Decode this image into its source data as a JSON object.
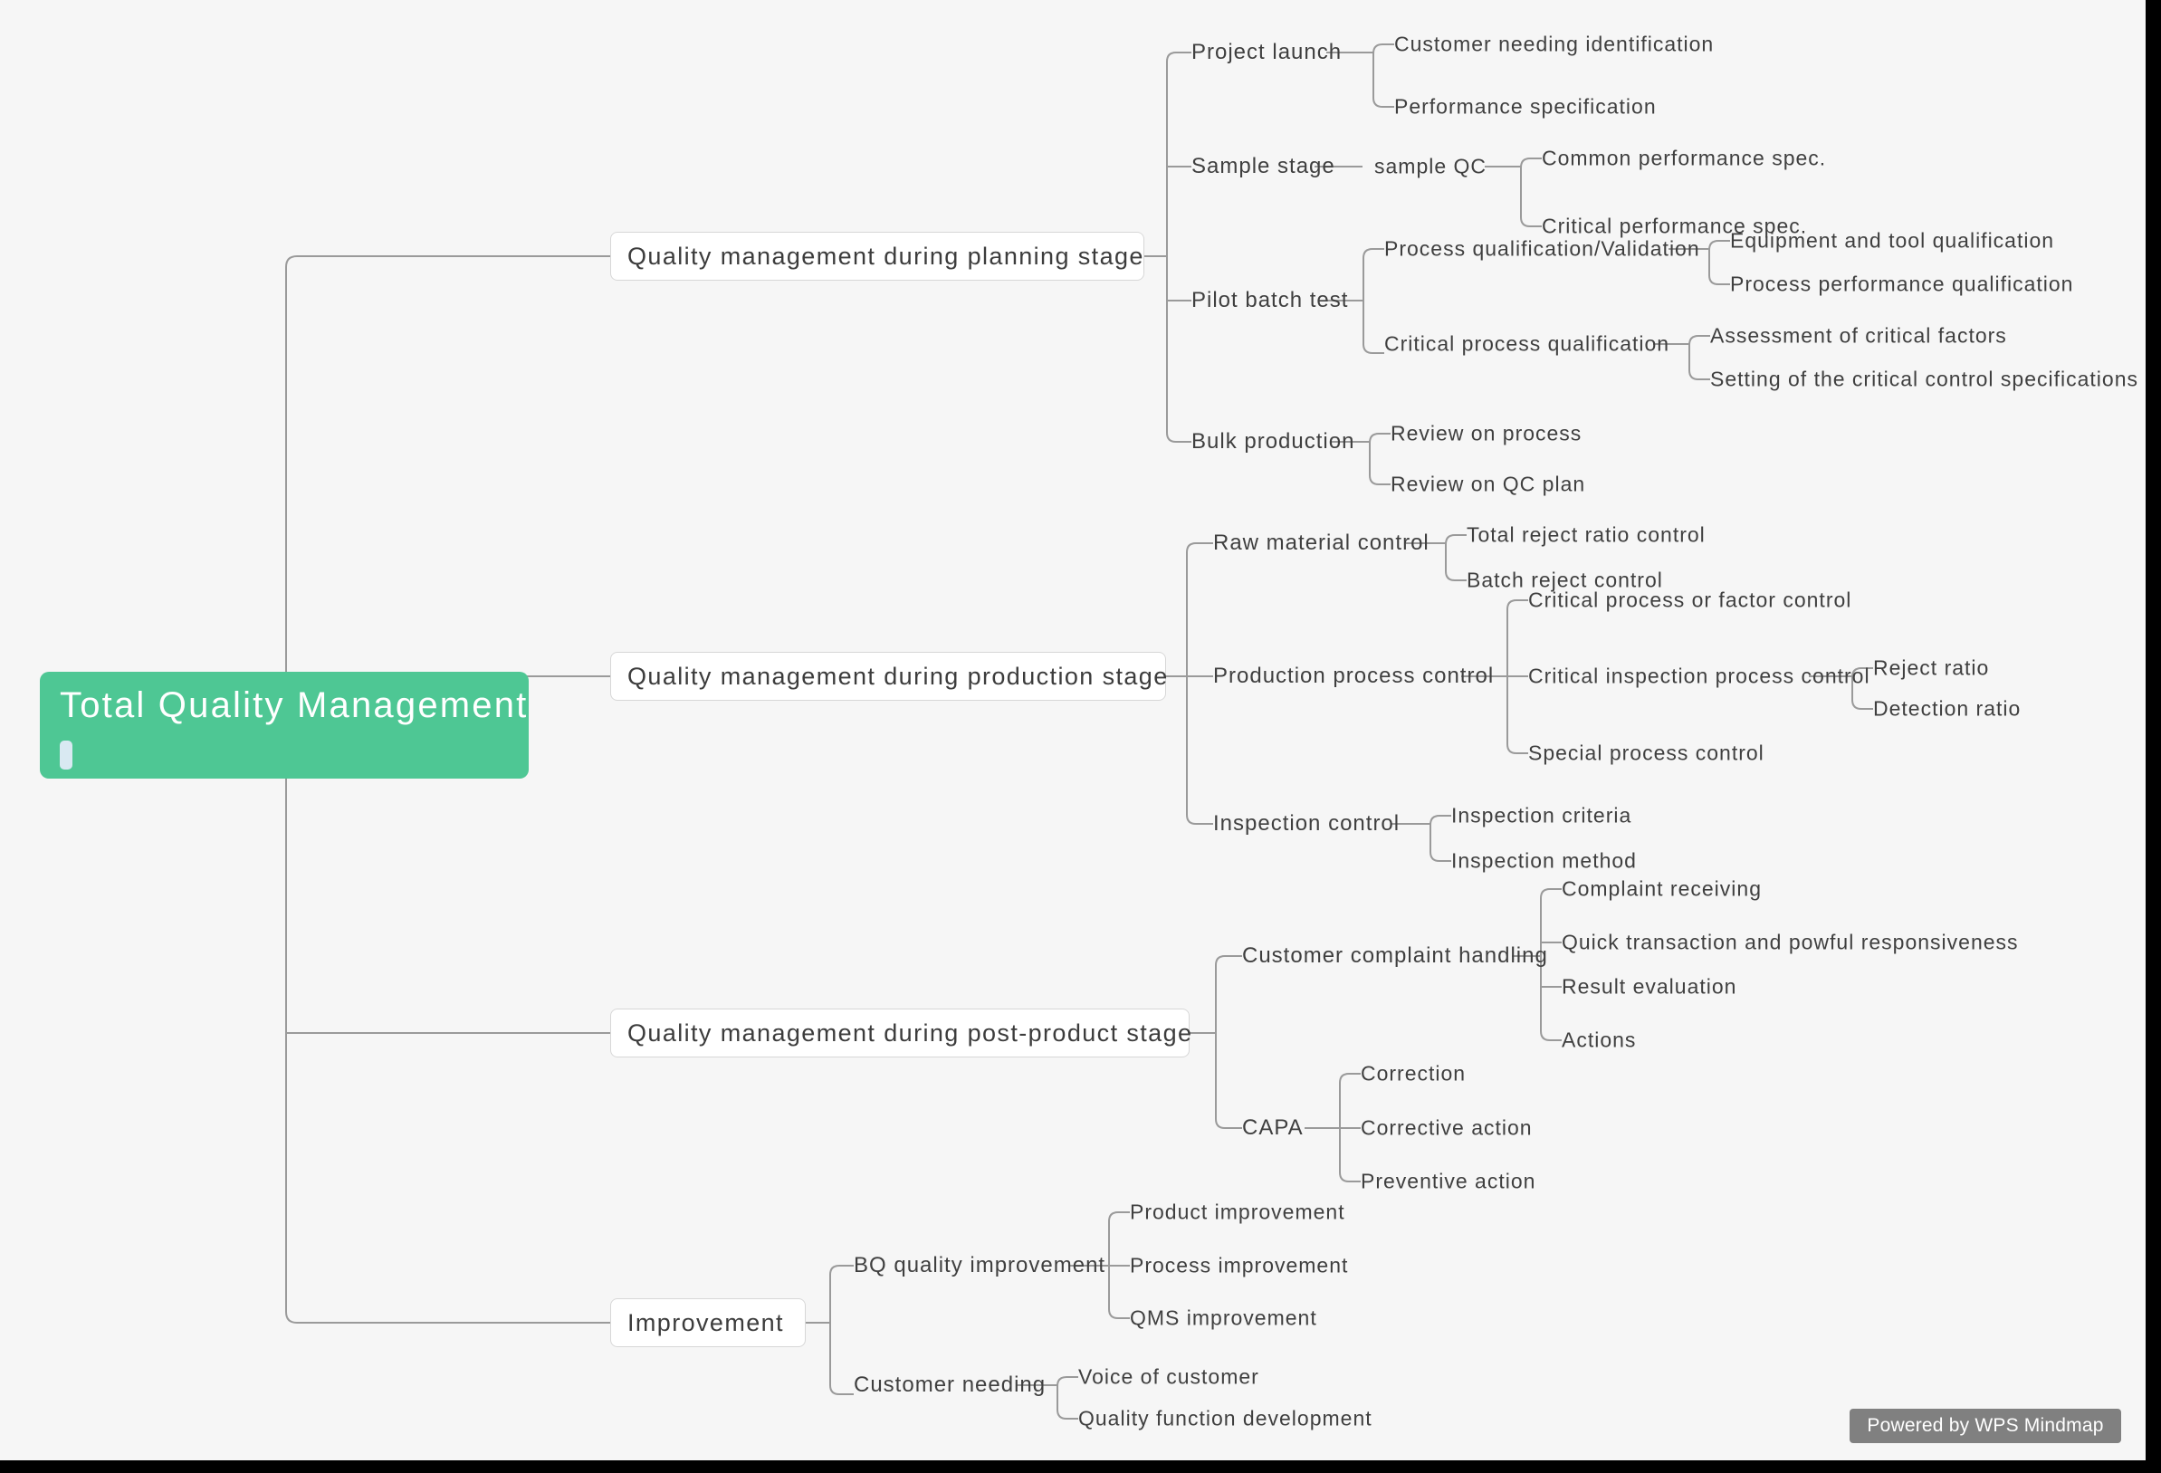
{
  "app": {
    "watermark": "Powered by WPS Mindmap",
    "background_color": "#f6f6f6",
    "line_color": "#9a9a9a",
    "root_color": "#4ec794",
    "node_text_color": "#3f3f3f"
  },
  "root": {
    "title": "Total  Quality  Management"
  },
  "branches": [
    {
      "label": "Quality  management  during  planning  stage",
      "children": [
        {
          "label": "Project  launch",
          "children": [
            {
              "label": "Customer  needing  identification"
            },
            {
              "label": "Performance  specification"
            }
          ]
        },
        {
          "label": "Sample  stage",
          "children": [
            {
              "label": "sample QC",
              "children": [
                {
                  "label": "Common  performance  spec."
                },
                {
                  "label": "Critical  performance  spec."
                }
              ]
            }
          ]
        },
        {
          "label": "Pilot  batch  test",
          "children": [
            {
              "label": "Process  qualification/Validation",
              "children": [
                {
                  "label": "Equipment  and  tool  qualification"
                },
                {
                  "label": "Process  performance  qualification"
                }
              ]
            },
            {
              "label": "Critical  process  qualification",
              "children": [
                {
                  "label": "Assessment  of  critical  factors"
                },
                {
                  "label": "Setting  of  the  critical  control  specifications"
                }
              ]
            }
          ]
        },
        {
          "label": "Bulk  production",
          "children": [
            {
              "label": "Review  on  process"
            },
            {
              "label": "Review  on  QC  plan"
            }
          ]
        }
      ]
    },
    {
      "label": "Quality  management  during  production  stage",
      "children": [
        {
          "label": "Raw  material  control",
          "children": [
            {
              "label": "Total  reject  ratio  control"
            },
            {
              "label": "Batch  reject  control"
            }
          ]
        },
        {
          "label": "Production  process  control",
          "children": [
            {
              "label": "Critical  process  or  factor  control"
            },
            {
              "label": "Critical  inspection  process  control",
              "children": [
                {
                  "label": "Reject  ratio"
                },
                {
                  "label": "Detection  ratio"
                }
              ]
            },
            {
              "label": "Special  process  control"
            }
          ]
        },
        {
          "label": "Inspection  control",
          "children": [
            {
              "label": "Inspection  criteria"
            },
            {
              "label": "Inspection  method"
            }
          ]
        }
      ]
    },
    {
      "label": "Quality  management  during  post-product  stage",
      "children": [
        {
          "label": "Customer  complaint  handling",
          "children": [
            {
              "label": "Complaint  receiving"
            },
            {
              "label": "Quick  transaction  and  powful  responsiveness"
            },
            {
              "label": "Result  evaluation"
            },
            {
              "label": "Actions"
            }
          ]
        },
        {
          "label": "CAPA",
          "children": [
            {
              "label": "Correction"
            },
            {
              "label": "Corrective  action"
            },
            {
              "label": "Preventive  action"
            }
          ]
        }
      ]
    },
    {
      "label": "Improvement",
      "children": [
        {
          "label": "BQ  quality  improvement",
          "children": [
            {
              "label": "Product  improvement"
            },
            {
              "label": "Process  improvement"
            },
            {
              "label": "QMS  improvement"
            }
          ]
        },
        {
          "label": "Customer  needing",
          "children": [
            {
              "label": "Voice  of  customer"
            },
            {
              "label": "Quality  function  development"
            }
          ]
        }
      ]
    }
  ]
}
